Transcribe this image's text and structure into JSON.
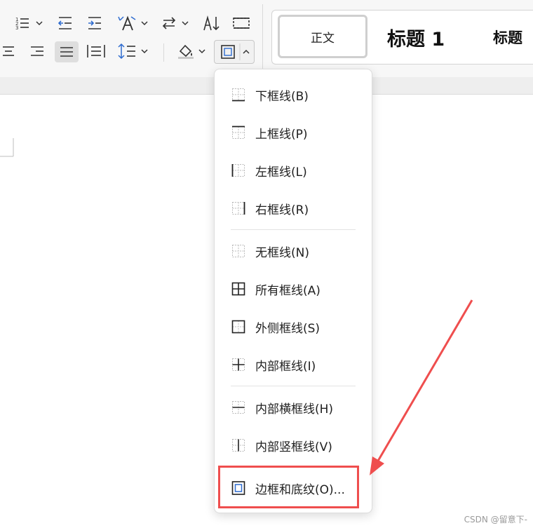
{
  "ribbon": {
    "buttons_row1": [
      {
        "name": "numbered-list-icon"
      },
      {
        "name": "decrease-indent-icon"
      },
      {
        "name": "increase-indent-icon"
      },
      {
        "name": "text-direction-icon"
      },
      {
        "name": "sort-swap-icon"
      },
      {
        "name": "sort-az-icon"
      },
      {
        "name": "table-grid-icon"
      }
    ],
    "buttons_row2": [
      {
        "name": "align-center-icon"
      },
      {
        "name": "align-right-icon"
      },
      {
        "name": "align-justify-icon"
      },
      {
        "name": "distributed-align-icon"
      },
      {
        "name": "line-spacing-icon"
      },
      {
        "name": "shading-fill-icon"
      },
      {
        "name": "border-icon"
      }
    ],
    "styles": {
      "normal": "正文",
      "heading1": "标题  1",
      "heading2": "标题"
    }
  },
  "menu": {
    "items": [
      {
        "label": "下框线(B)",
        "icon": "bottom-border-icon"
      },
      {
        "label": "上框线(P)",
        "icon": "top-border-icon"
      },
      {
        "label": "左框线(L)",
        "icon": "left-border-icon"
      },
      {
        "label": "右框线(R)",
        "icon": "right-border-icon"
      },
      {
        "label": "无框线(N)",
        "icon": "no-border-icon"
      },
      {
        "label": "所有框线(A)",
        "icon": "all-borders-icon"
      },
      {
        "label": "外侧框线(S)",
        "icon": "outside-borders-icon"
      },
      {
        "label": "内部框线(I)",
        "icon": "inside-borders-icon"
      },
      {
        "label": "内部横框线(H)",
        "icon": "inside-horizontal-border-icon"
      },
      {
        "label": "内部竖框线(V)",
        "icon": "inside-vertical-border-icon"
      },
      {
        "label": "边框和底纹(O)...",
        "icon": "borders-and-shading-icon"
      }
    ]
  },
  "annotation": {
    "highlight_color": "#ef4e4e"
  },
  "watermark": "CSDN @留意下-"
}
